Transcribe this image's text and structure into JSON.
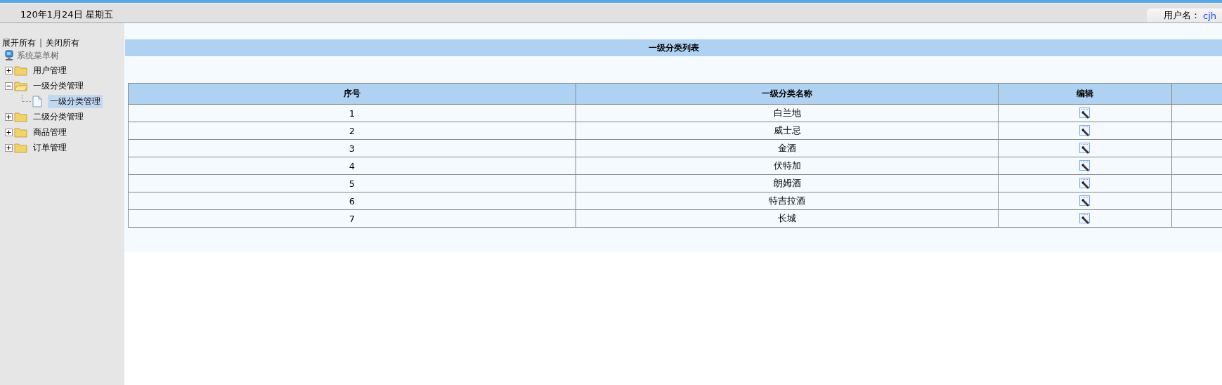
{
  "header": {
    "date": "120年1月24日 星期五",
    "user_label": "用户名：",
    "user_name": "cjh"
  },
  "sidebar": {
    "expand_all": "展开所有",
    "separator": "|",
    "collapse_all": "关闭所有",
    "tree_root": "系统菜单树",
    "items": [
      {
        "label": "用户管理",
        "expanded": false,
        "selected": false
      },
      {
        "label": "一级分类管理",
        "expanded": true,
        "selected": false,
        "children": [
          {
            "label": "一级分类管理",
            "selected": true
          }
        ]
      },
      {
        "label": "二级分类管理",
        "expanded": false,
        "selected": false
      },
      {
        "label": "商品管理",
        "expanded": false,
        "selected": false
      },
      {
        "label": "订单管理",
        "expanded": false,
        "selected": false
      }
    ]
  },
  "panel": {
    "title": "一级分类列表"
  },
  "table": {
    "columns": [
      "序号",
      "一级分类名称",
      "编辑"
    ],
    "rows": [
      {
        "index": "1",
        "name": "白兰地"
      },
      {
        "index": "2",
        "name": "威士忌"
      },
      {
        "index": "3",
        "name": "金酒"
      },
      {
        "index": "4",
        "name": "伏特加"
      },
      {
        "index": "5",
        "name": "朗姆酒"
      },
      {
        "index": "6",
        "name": "特吉拉酒"
      },
      {
        "index": "7",
        "name": "长城"
      }
    ]
  }
}
